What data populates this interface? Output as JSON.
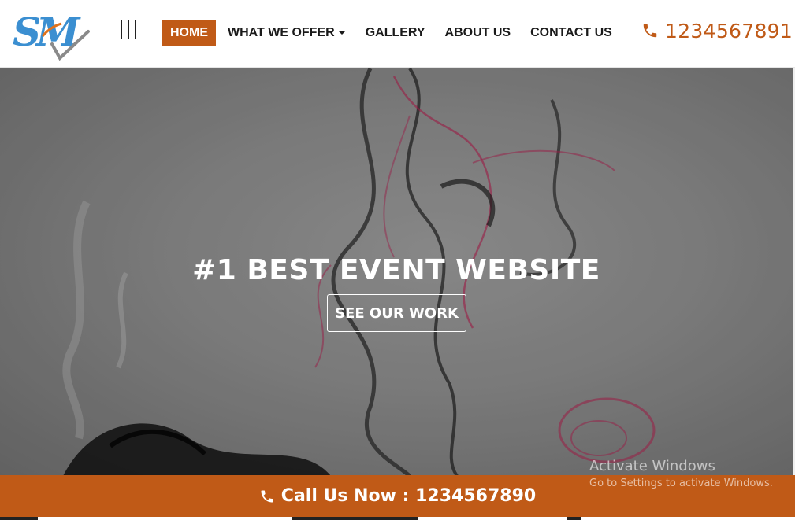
{
  "header": {
    "logo_text": "SM",
    "nav": {
      "home": "HOME",
      "what_we_offer": "WHAT WE OFFER",
      "gallery": "GALLERY",
      "about_us": "ABOUT US",
      "contact_us": "CONTACT US"
    },
    "phone": "1234567891",
    "phone_icon": "phone-icon",
    "menu_icon": "menu-bars-icon"
  },
  "hero": {
    "title": "#1 BEST EVENT WEBSITE",
    "button_label": "SEE OUR WORK"
  },
  "callbar": {
    "text": "Call Us Now : 1234567890",
    "icon": "phone-icon"
  },
  "watermark": {
    "title": "Activate Windows",
    "subtitle": "Go to Settings to activate Windows."
  },
  "colors": {
    "accent": "#c05a17",
    "logo_blue": "#3b8fd1",
    "logo_orange": "#e0721c",
    "ink_pink": "#b0204f"
  }
}
